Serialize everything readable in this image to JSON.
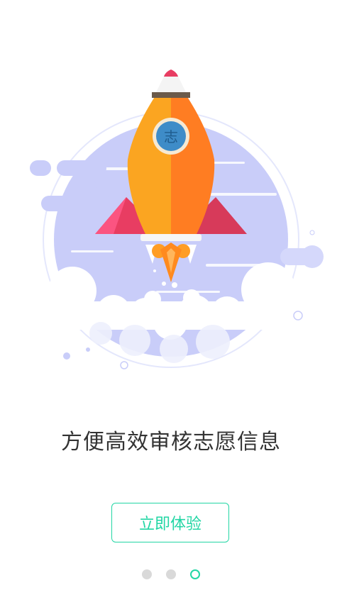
{
  "onboarding": {
    "headline": "方便高效审核志愿信息",
    "cta_label": "立即体验",
    "page_indicator": {
      "total": 3,
      "current": 3
    },
    "rocket_badge": "志"
  },
  "colors": {
    "accent": "#22d6a4",
    "dot_inactive": "#d9d9d9",
    "planet": "#c9cdf9",
    "rocket_left": "#fba521",
    "rocket_right": "#ff7d22",
    "wing": "#e83d62"
  },
  "icons": {
    "illustration": "rocket-launch-illustration"
  }
}
